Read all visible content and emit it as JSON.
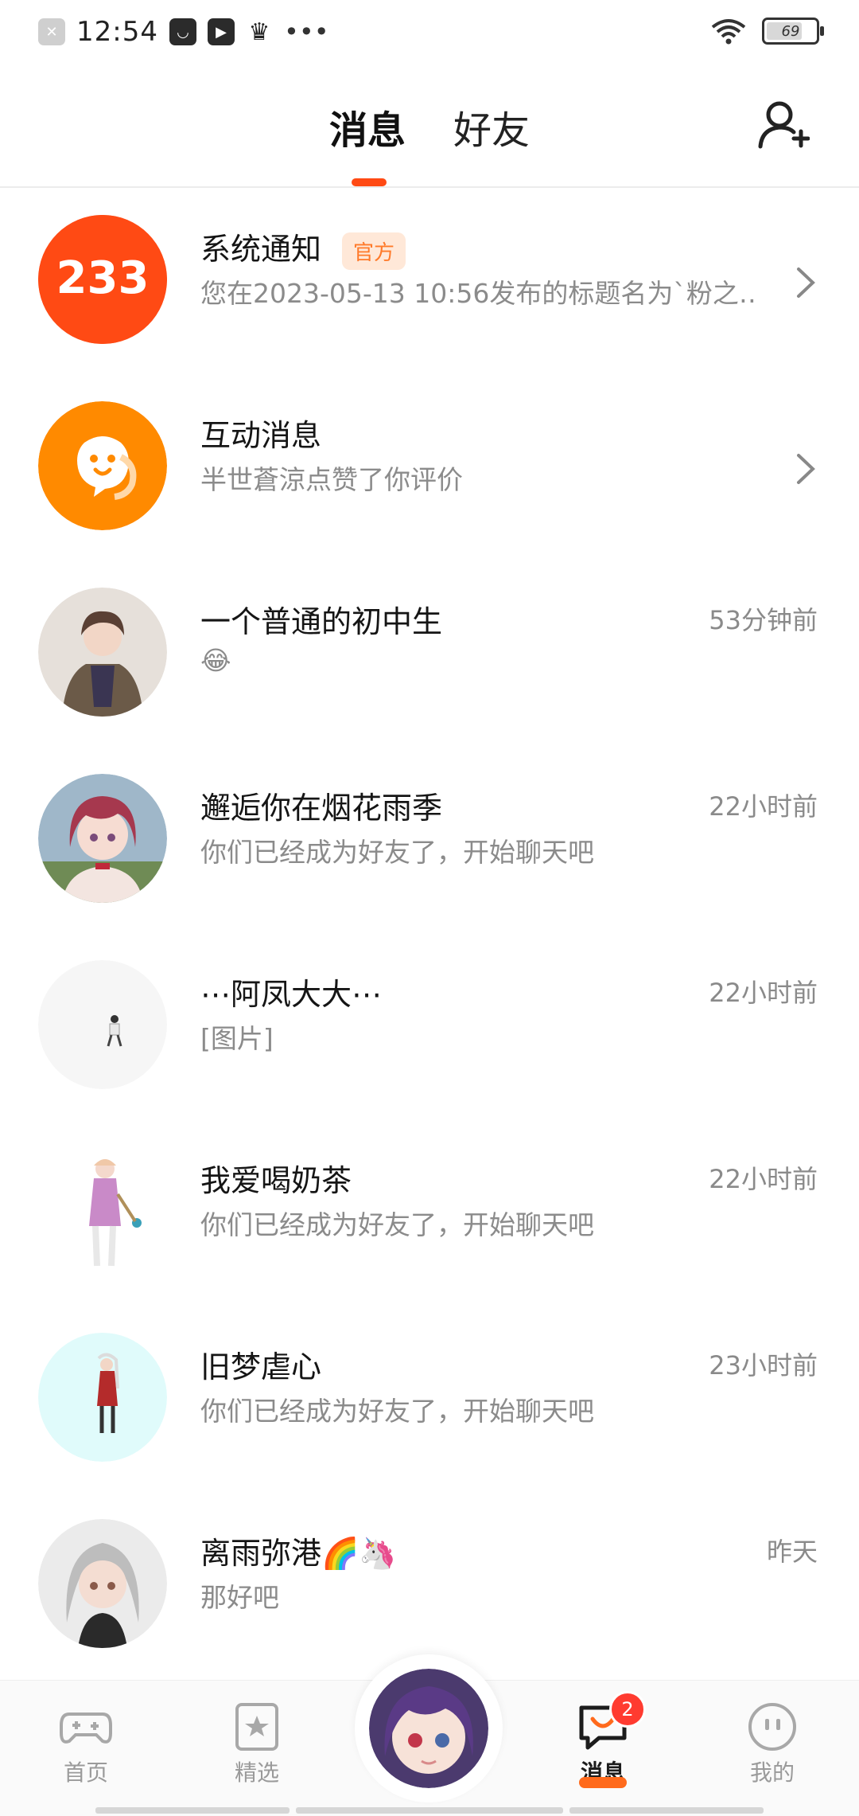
{
  "status_bar": {
    "time": "12:54",
    "battery": "69",
    "more": "•••"
  },
  "header": {
    "tabs": [
      {
        "label": "消息",
        "active": true
      },
      {
        "label": "好友",
        "active": false
      }
    ],
    "add_friend_icon": "add-user-icon"
  },
  "conversations": [
    {
      "title": "系统通知",
      "badge": "官方",
      "subtitle": "您在2023-05-13 10:56发布的标题名为`粉之…",
      "time": "",
      "arrow": true,
      "avatar_text": "233",
      "avatar_color": "#ff4a14"
    },
    {
      "title": "互动消息",
      "badge": "",
      "subtitle": "半世蒼涼点赞了你评价",
      "time": "",
      "arrow": true,
      "avatar_color": "#ff8a00"
    },
    {
      "title": "一个普通的初中生",
      "badge": "",
      "subtitle": "😂",
      "time": "53分钟前",
      "arrow": false
    },
    {
      "title": "邂逅你在烟花雨季",
      "badge": "",
      "subtitle": "你们已经成为好友了，开始聊天吧",
      "time": "22小时前",
      "arrow": false
    },
    {
      "title": "⋯阿凤大大⋯",
      "badge": "",
      "subtitle": "[图片]",
      "time": "22小时前",
      "arrow": false
    },
    {
      "title": "我爱喝奶茶",
      "badge": "",
      "subtitle": "你们已经成为好友了，开始聊天吧",
      "time": "22小时前",
      "arrow": false
    },
    {
      "title": "旧梦虐心",
      "badge": "",
      "subtitle": "你们已经成为好友了，开始聊天吧",
      "time": "23小时前",
      "arrow": false
    },
    {
      "title": "离雨弥港🌈🦄",
      "badge": "",
      "subtitle": "那好吧",
      "time": "昨天",
      "arrow": false
    }
  ],
  "bottom_nav": {
    "items": [
      {
        "label": "首页",
        "icon": "gamepad-icon",
        "active": false
      },
      {
        "label": "精选",
        "icon": "star-icon",
        "active": false
      },
      {
        "label": "消息",
        "icon": "chat-icon",
        "active": true
      },
      {
        "label": "我的",
        "icon": "face-icon",
        "active": false
      }
    ],
    "unread_count": "2"
  },
  "colors": {
    "accent": "#ff4a14",
    "orange": "#ff8a00",
    "muted_text": "#8b8b8b",
    "badge_red": "#ff3b30"
  }
}
